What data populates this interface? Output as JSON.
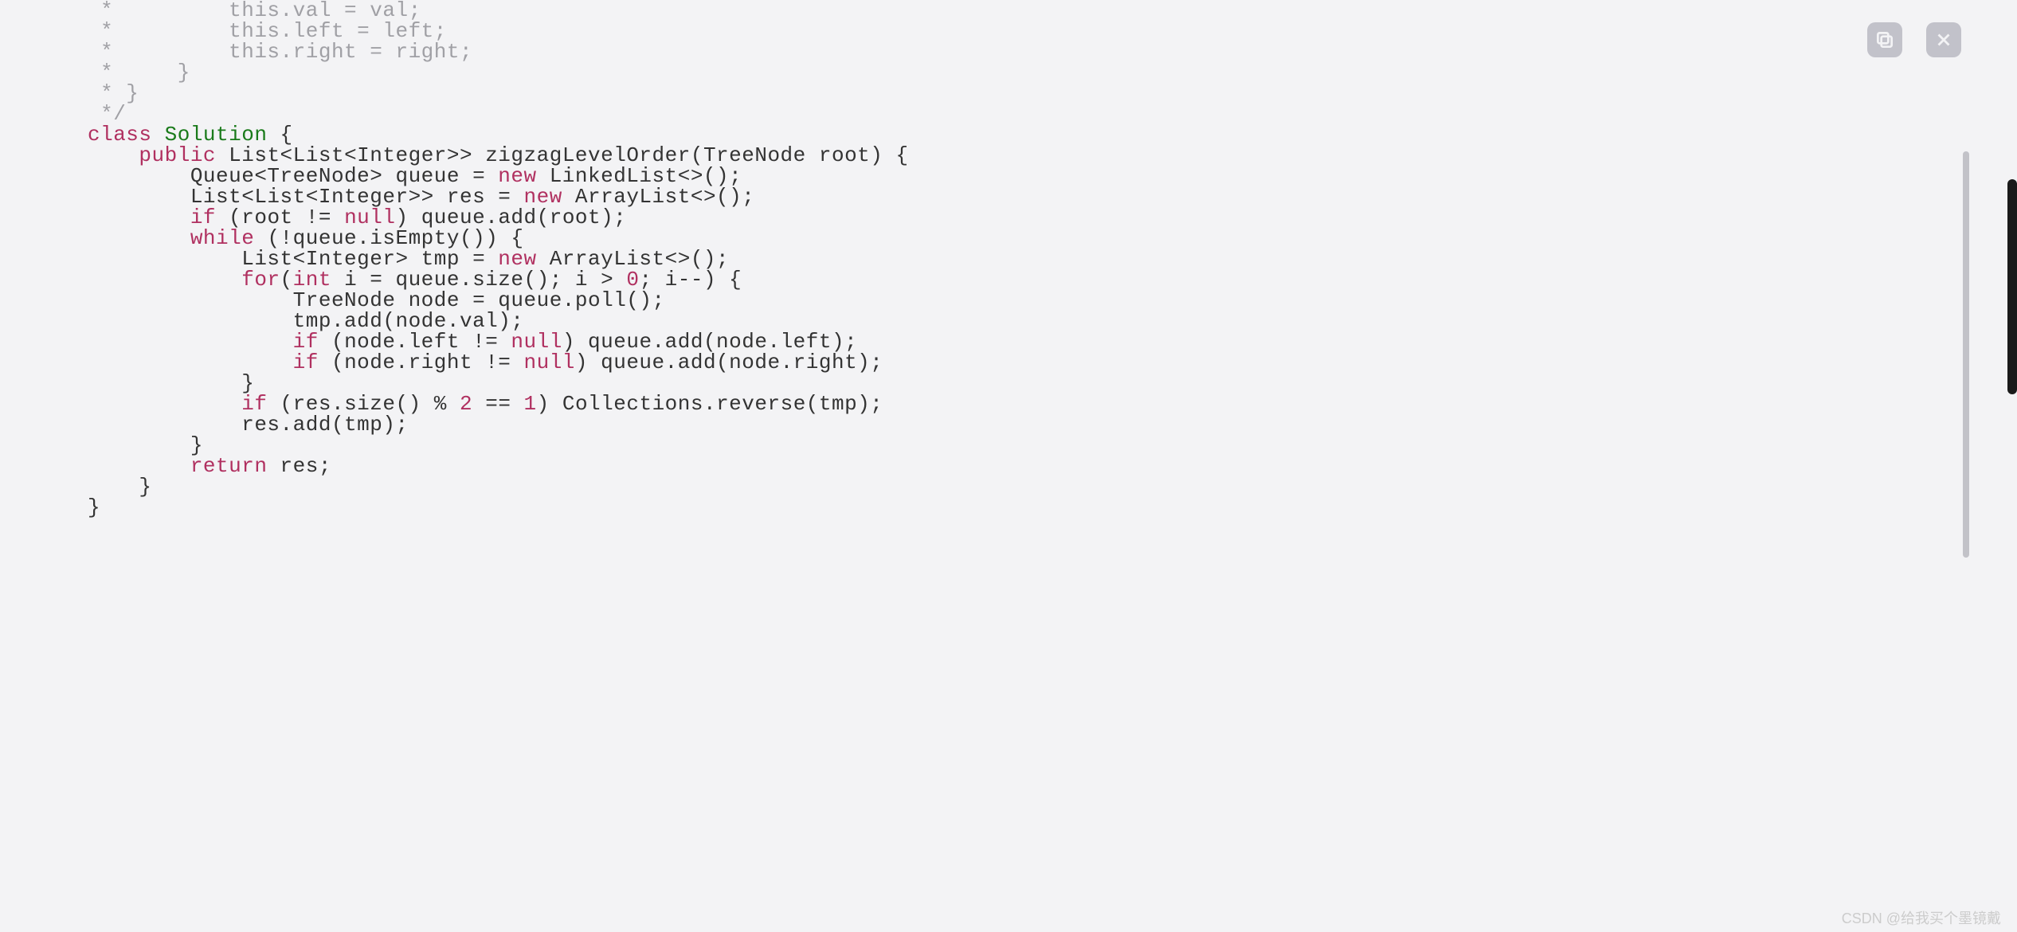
{
  "code": {
    "lines": [
      {
        "segments": [
          {
            "cls": "comment",
            "t": " *         this.val = val;"
          }
        ]
      },
      {
        "segments": [
          {
            "cls": "comment",
            "t": " *         this.left = left;"
          }
        ]
      },
      {
        "segments": [
          {
            "cls": "comment",
            "t": " *         this.right = right;"
          }
        ]
      },
      {
        "segments": [
          {
            "cls": "comment",
            "t": " *     }"
          }
        ]
      },
      {
        "segments": [
          {
            "cls": "comment",
            "t": " * }"
          }
        ]
      },
      {
        "segments": [
          {
            "cls": "comment",
            "t": " */"
          }
        ]
      },
      {
        "segments": [
          {
            "cls": "keyword",
            "t": "class"
          },
          {
            "cls": "plain",
            "t": " "
          },
          {
            "cls": "type",
            "t": "Solution"
          },
          {
            "cls": "plain",
            "t": " {"
          }
        ]
      },
      {
        "segments": [
          {
            "cls": "plain",
            "t": "    "
          },
          {
            "cls": "keyword",
            "t": "public"
          },
          {
            "cls": "plain",
            "t": " List<List<Integer>> zigzagLevelOrder(TreeNode root) {"
          }
        ]
      },
      {
        "segments": [
          {
            "cls": "plain",
            "t": "        Queue<TreeNode> queue = "
          },
          {
            "cls": "keyword",
            "t": "new"
          },
          {
            "cls": "plain",
            "t": " LinkedList<>();"
          }
        ]
      },
      {
        "segments": [
          {
            "cls": "plain",
            "t": "        List<List<Integer>> res = "
          },
          {
            "cls": "keyword",
            "t": "new"
          },
          {
            "cls": "plain",
            "t": " ArrayList<>();"
          }
        ]
      },
      {
        "segments": [
          {
            "cls": "plain",
            "t": "        "
          },
          {
            "cls": "keyword",
            "t": "if"
          },
          {
            "cls": "plain",
            "t": " (root != "
          },
          {
            "cls": "keyword",
            "t": "null"
          },
          {
            "cls": "plain",
            "t": ") queue.add(root);"
          }
        ]
      },
      {
        "segments": [
          {
            "cls": "plain",
            "t": "        "
          },
          {
            "cls": "keyword",
            "t": "while"
          },
          {
            "cls": "plain",
            "t": " (!queue.isEmpty()) {"
          }
        ]
      },
      {
        "segments": [
          {
            "cls": "plain",
            "t": "            List<Integer> tmp = "
          },
          {
            "cls": "keyword",
            "t": "new"
          },
          {
            "cls": "plain",
            "t": " ArrayList<>();"
          }
        ]
      },
      {
        "segments": [
          {
            "cls": "plain",
            "t": "            "
          },
          {
            "cls": "keyword",
            "t": "for"
          },
          {
            "cls": "plain",
            "t": "("
          },
          {
            "cls": "keyword",
            "t": "int"
          },
          {
            "cls": "plain",
            "t": " i = queue.size(); i > "
          },
          {
            "cls": "keyword",
            "t": "0"
          },
          {
            "cls": "plain",
            "t": "; i--) {"
          }
        ]
      },
      {
        "segments": [
          {
            "cls": "plain",
            "t": "                TreeNode node = queue.poll();"
          }
        ]
      },
      {
        "segments": [
          {
            "cls": "plain",
            "t": "                tmp.add(node.val);"
          }
        ]
      },
      {
        "segments": [
          {
            "cls": "plain",
            "t": "                "
          },
          {
            "cls": "keyword",
            "t": "if"
          },
          {
            "cls": "plain",
            "t": " (node.left != "
          },
          {
            "cls": "keyword",
            "t": "null"
          },
          {
            "cls": "plain",
            "t": ") queue.add(node.left);"
          }
        ]
      },
      {
        "segments": [
          {
            "cls": "plain",
            "t": "                "
          },
          {
            "cls": "keyword",
            "t": "if"
          },
          {
            "cls": "plain",
            "t": " (node.right != "
          },
          {
            "cls": "keyword",
            "t": "null"
          },
          {
            "cls": "plain",
            "t": ") queue.add(node.right);"
          }
        ]
      },
      {
        "segments": [
          {
            "cls": "plain",
            "t": "            }"
          }
        ]
      },
      {
        "segments": [
          {
            "cls": "plain",
            "t": "            "
          },
          {
            "cls": "keyword",
            "t": "if"
          },
          {
            "cls": "plain",
            "t": " (res.size() % "
          },
          {
            "cls": "keyword",
            "t": "2"
          },
          {
            "cls": "plain",
            "t": " == "
          },
          {
            "cls": "keyword",
            "t": "1"
          },
          {
            "cls": "plain",
            "t": ") Collections.reverse(tmp);"
          }
        ]
      },
      {
        "segments": [
          {
            "cls": "plain",
            "t": "            res.add(tmp);"
          }
        ]
      },
      {
        "segments": [
          {
            "cls": "plain",
            "t": "        }"
          }
        ]
      },
      {
        "segments": [
          {
            "cls": "plain",
            "t": "        "
          },
          {
            "cls": "keyword",
            "t": "return"
          },
          {
            "cls": "plain",
            "t": " res;"
          }
        ]
      },
      {
        "segments": [
          {
            "cls": "plain",
            "t": "    }"
          }
        ]
      },
      {
        "segments": [
          {
            "cls": "plain",
            "t": "}"
          }
        ]
      }
    ]
  },
  "toolbar": {
    "copy": "copy",
    "close": "close"
  },
  "watermark": "CSDN @给我买个墨镜戴"
}
